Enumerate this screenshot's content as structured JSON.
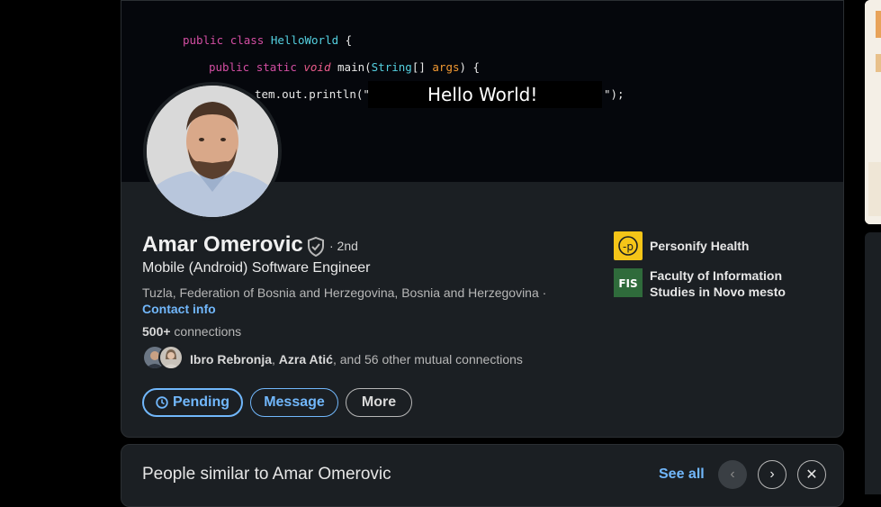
{
  "banner": {
    "code_lines": [
      {
        "kw1": "public",
        "kw2": "class",
        "name": "HelloWorld",
        "rest": "{"
      },
      {
        "kw1": "public",
        "kw2": "static",
        "void": "void",
        "method": "main(",
        "type": "String",
        "brackets": "[] ",
        "arg": "args",
        "rest": ") {"
      },
      {
        "partial": "tem.out.println(\"",
        "end": "\");"
      }
    ],
    "hello_text": "Hello World!"
  },
  "profile": {
    "name": "Amar Omerovic",
    "degree": "· 2nd",
    "headline": "Mobile (Android) Software Engineer",
    "location": "Tuzla, Federation of Bosnia and Herzegovina, Bosnia and Herzegovina ·",
    "contact_info": "Contact info",
    "connections_count": "500+",
    "connections_label": " connections",
    "mutual": {
      "name1": "Ibro Rebronja",
      "sep": ", ",
      "name2": "Azra Atić",
      "rest": ", and 56 other mutual connections"
    }
  },
  "actions": {
    "pending": "Pending",
    "message": "Message",
    "more": "More"
  },
  "orgs": [
    {
      "name": "Personify Health",
      "logo_text": "-p"
    },
    {
      "name_line1": "Faculty of Information",
      "name_line2": "Studies in Novo mesto",
      "logo_text": "FIS"
    }
  ],
  "similar": {
    "title": "People similar to Amar Omerovic",
    "see_all": "See all"
  },
  "colors": {
    "accent": "#71b7fb",
    "card_bg": "#1b1f23",
    "page_bg": "#000000"
  }
}
